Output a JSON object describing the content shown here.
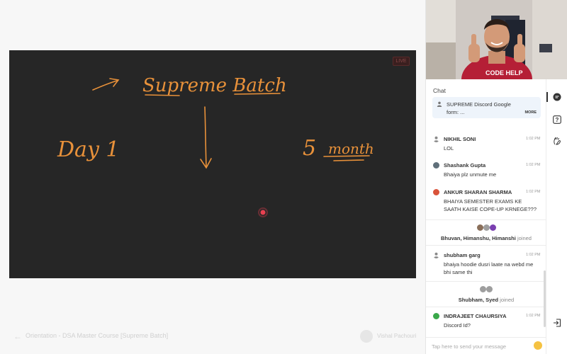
{
  "stage": {
    "live_label": "LIVE",
    "board_text": {
      "title": "Supreme Batch",
      "day": "Day 1",
      "months_number": "5",
      "months_word": "month"
    }
  },
  "bottom_bar": {
    "course_title": "Orientation - DSA Master Course [Supreme Batch]",
    "educator_name": "Vishal Pachouri"
  },
  "chat": {
    "label": "Chat",
    "pinned": {
      "text": "SUPREME Discord Google form: ...",
      "more_label": "MORE"
    },
    "messages": [
      {
        "name": "NIKHIL SONI",
        "time": "1:02 PM",
        "text": "LOL",
        "avatar_color": "#9e9e9e"
      },
      {
        "name": "Shashank Gupta",
        "time": "1:02 PM",
        "text": "Bhaiya plz unmute me",
        "avatar_color": "#5f6f7a"
      },
      {
        "name": "ANKUR SHARAN SHARMA",
        "time": "1:02 PM",
        "text": "BHAIYA SEMESTER EXAMS KE SAATH KAISE COPE-UP KRNEGE???",
        "avatar_color": "#d9533a"
      },
      {
        "name": "shubham garg",
        "time": "1:02 PM",
        "text": "bhaiya hoodie dusri laate na webd me bhi same thi",
        "avatar_color": "#9e9e9e"
      },
      {
        "name": "INDRAJEET CHAURSIYA",
        "time": "1:02 PM",
        "text": "Discord Id?",
        "avatar_color": "#3aa84a"
      }
    ],
    "joins": [
      {
        "names": "Bhuvan, Himanshu, Himanshi",
        "suffix": "joined"
      },
      {
        "names": "Shubham, Syed",
        "suffix": "joined"
      }
    ],
    "input_placeholder": "Tap here to send your message"
  },
  "rail": {
    "icons": [
      "chat-icon",
      "question-icon",
      "hand-raise-icon",
      "exit-icon"
    ]
  },
  "colors": {
    "board_bg": "#262626",
    "ink": "#e8913a",
    "pinned_bg": "#eef4fb"
  }
}
